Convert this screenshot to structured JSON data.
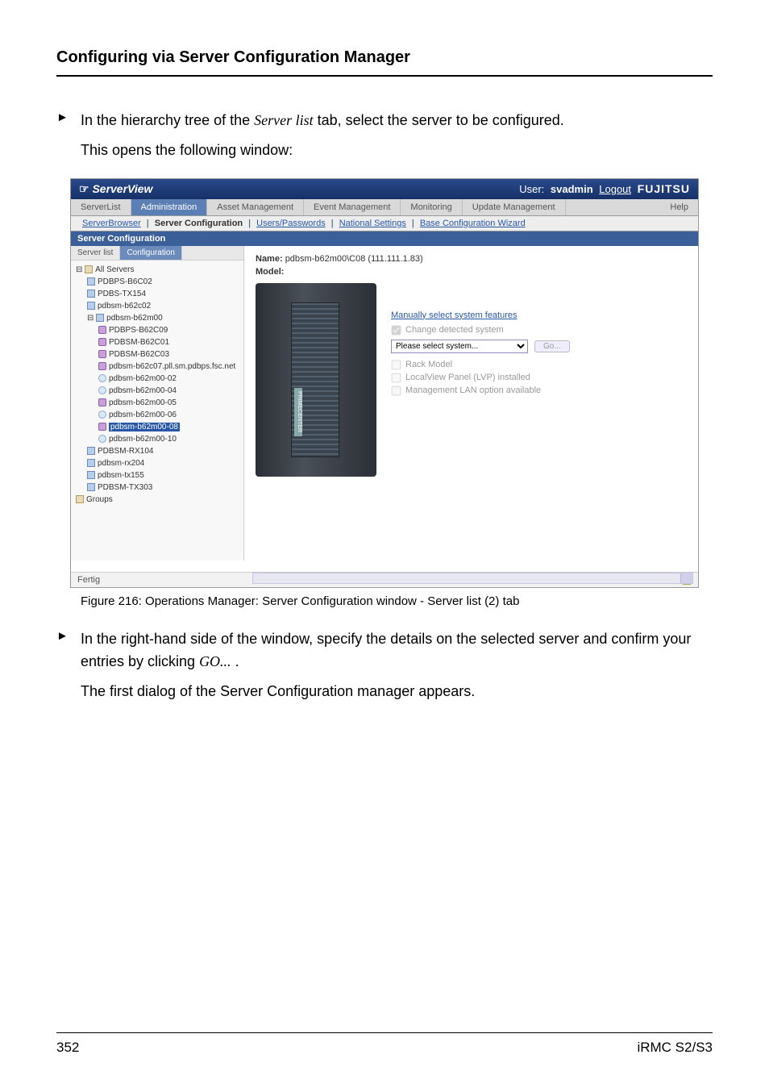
{
  "doc": {
    "heading": "Configuring via Server Configuration Manager",
    "bullet1": "In the hierarchy tree of the ",
    "bullet1_italic": "Server list",
    "bullet1_tail": " tab, select the server to be configured.",
    "bullet1_sub": "This opens the following window:",
    "fig_caption": "Figure 216: Operations Manager: Server Configuration window - Server list (2) tab",
    "bullet2a": "In the right-hand side of the window, specify the details on the selected server and confirm your entries by clicking ",
    "bullet2_italic": "GO...",
    "bullet2_tail": " .",
    "bullet2_sub": "The first dialog of the Server Configuration manager appears.",
    "page_num": "352",
    "product": "iRMC S2/S3"
  },
  "sv": {
    "title": "ServerView",
    "user_label": "User:",
    "user_name": "svadmin",
    "logout": "Logout",
    "brand": "FUJITSU",
    "nav": {
      "serverlist": "ServerList",
      "administration": "Administration",
      "asset": "Asset Management",
      "event": "Event Management",
      "monitoring": "Monitoring",
      "update": "Update Management",
      "help": "Help"
    },
    "subnav": {
      "browser": "ServerBrowser",
      "servercfg": "Server Configuration",
      "users": "Users/Passwords",
      "national": "National Settings",
      "basecfg": "Base Configuration Wizard"
    },
    "section": "Server Configuration",
    "tree_tabs": {
      "serverlist": "Server list",
      "configuration": "Configuration"
    },
    "tree": {
      "root": "All Servers",
      "n1": "PDBPS-B6C02",
      "n2": "PDBS-TX154",
      "n3": "pdbsm-b62c02",
      "n4": "pdbsm-b62m00",
      "n4a": "PDBPS-B62C09",
      "n4b": "PDBSM-B62C01",
      "n4c": "PDBSM-B62C03",
      "n4d": "pdbsm-b62c07.pll.sm.pdbps.fsc.net",
      "n4e": "pdbsm-b62m00-02",
      "n4f": "pdbsm-b62m00-04",
      "n4g": "pdbsm-b62m00-05",
      "n4h": "pdbsm-b62m00-06",
      "n4i": "pdbsm-b62m00-08",
      "n4j": "pdbsm-b62m00-10",
      "n5": "PDBSM-RX104",
      "n6": "pdbsm-rx204",
      "n7": "pdbsm-tx155",
      "n8": "PDBSM-TX303",
      "groups": "Groups"
    },
    "details": {
      "name_label": "Name:",
      "name_value": "pdbsm-b62m00\\C08 (111.111.1.83)",
      "model_label": "Model:",
      "manual_head": "Manually select system features",
      "chk_change": "Change detected system",
      "select_placeholder": "Please select system...",
      "go": "Go...",
      "chk_rack": "Rack Model",
      "chk_lvp": "LocalView Panel (LVP) installed",
      "chk_lan": "Management LAN option available"
    },
    "footer": "Fertig"
  }
}
